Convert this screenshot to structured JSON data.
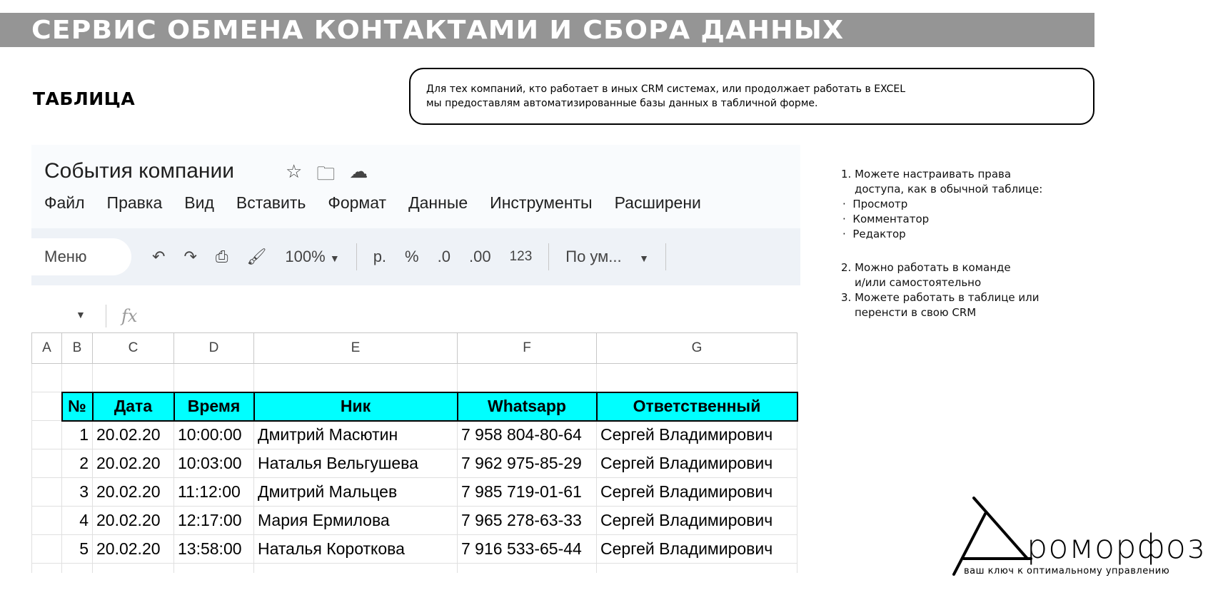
{
  "header": {
    "title": "СЕРВИС ОБМЕНА КОНТАКТАМИ И СБОРА ДАННЫХ",
    "subtitle": "ТАБЛИЦА"
  },
  "info": {
    "line1": "Для тех компаний, кто работает в иных CRM системах, или продолжает работать в EXCEL",
    "line2": "мы предоставлям автоматизированные базы данных в табличной форме."
  },
  "sheet": {
    "title": "События компании",
    "menu": [
      "Файл",
      "Правка",
      "Вид",
      "Вставить",
      "Формат",
      "Данные",
      "Инструменты",
      "Расширени"
    ],
    "toolbar": {
      "menu": "Меню",
      "zoom": "100%",
      "currency": "р.",
      "percent": "%",
      "dec_less": ".0",
      "dec_more": ".00",
      "number": "123",
      "font": "По ум..."
    },
    "fx": "fx",
    "columns": [
      "A",
      "B",
      "C",
      "D",
      "E",
      "F",
      "G"
    ],
    "headers": [
      "№",
      "Дата",
      "Время",
      "Ник",
      "Whatsapp",
      "Ответственный"
    ],
    "rows": [
      [
        "1",
        "20.02.20",
        "10:00:00",
        "Дмитрий Масютин",
        "7 958 804-80-64",
        "Сергей Владимирович"
      ],
      [
        "2",
        "20.02.20",
        "10:03:00",
        "Наталья Вельгушева",
        "7 962 975-85-29",
        "Сергей Владимирович"
      ],
      [
        "3",
        "20.02.20",
        "11:12:00",
        "Дмитрий Мальцев",
        "7 985 719-01-61",
        "Сергей Владимирович"
      ],
      [
        "4",
        "20.02.20",
        "12:17:00",
        "Мария Ермилова",
        "7 965 278-63-33",
        "Сергей Владимирович"
      ],
      [
        "5",
        "20.02.20",
        "13:58:00",
        "Наталья Короткова",
        "7 916 533-65-44",
        "Сергей Владимирович"
      ]
    ],
    "header_color": "#00ffff"
  },
  "notes": {
    "item1a": "1. Можете настраивать права",
    "item1b": "доступа, как в обычной таблице:",
    "bullets": [
      "Просмотр",
      "Комментатор",
      "Редактор"
    ],
    "item2a": "2. Можно работать в команде",
    "item2b": "и/или самостоятельно",
    "item3a": "3. Можете работать в таблице или",
    "item3b": "перенсти в свою CRM"
  },
  "logo": {
    "name": "ромрфоз",
    "tagline": "ваш ключ к оптимальному управлению"
  }
}
